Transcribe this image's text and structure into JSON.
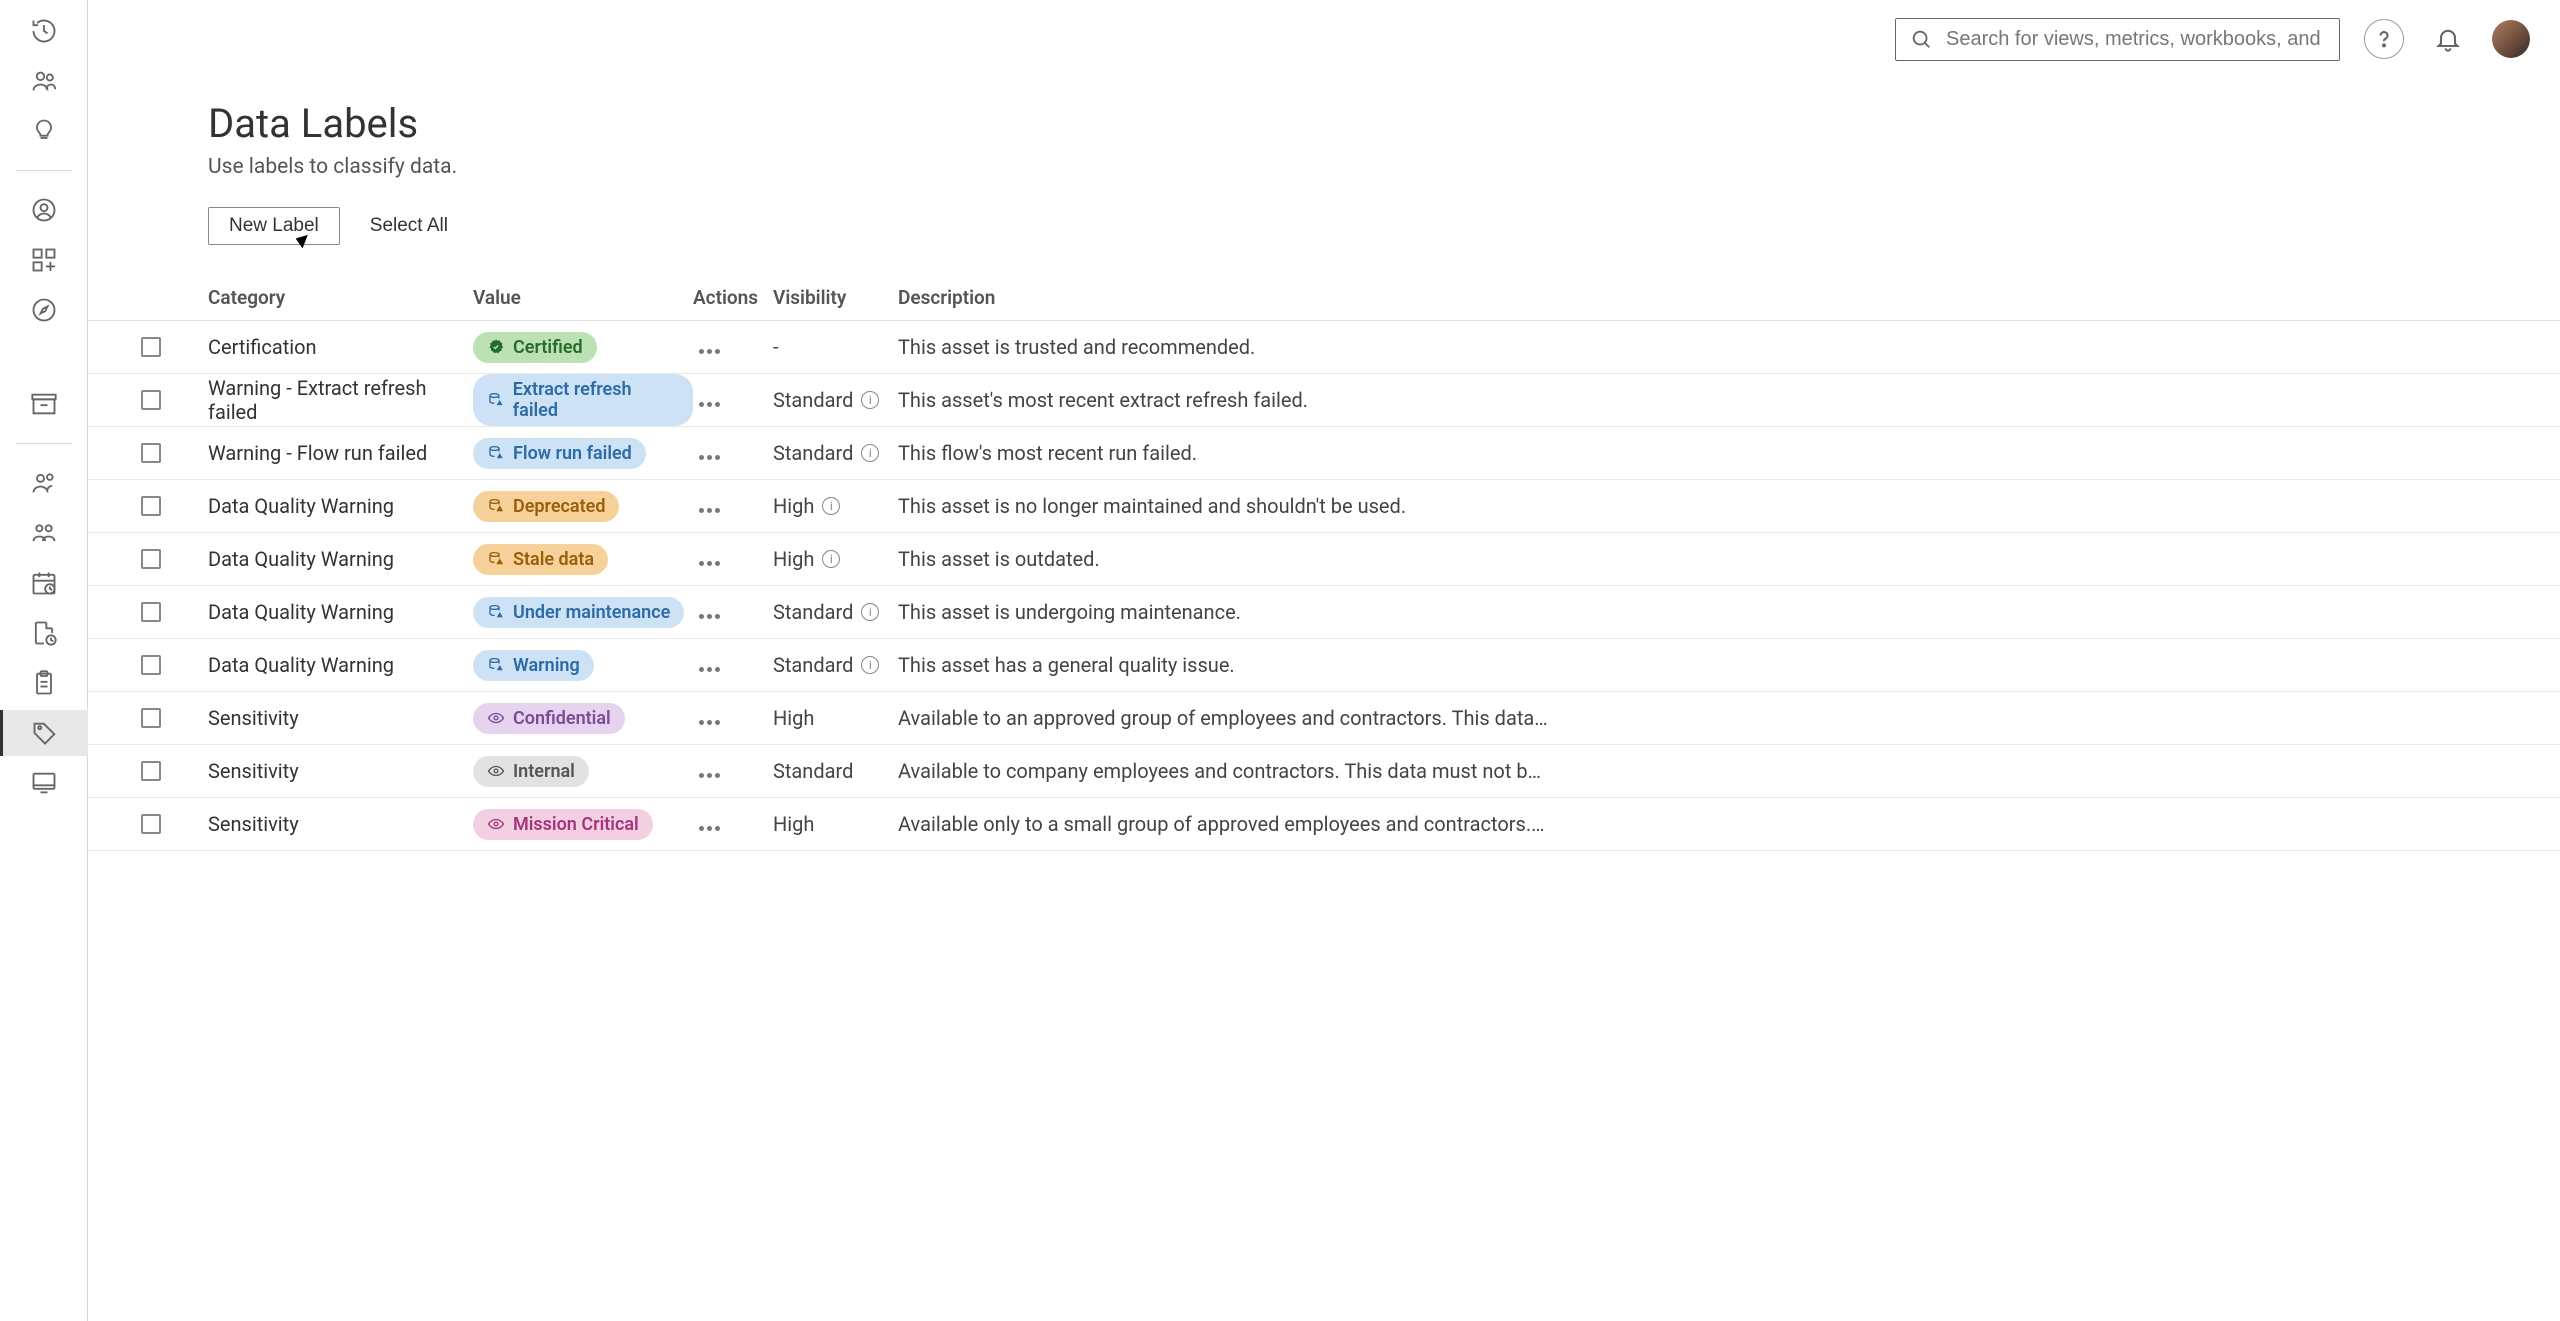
{
  "topbar": {
    "search_placeholder": "Search for views, metrics, workbooks, and more"
  },
  "page": {
    "title": "Data Labels",
    "subtitle": "Use labels to classify data.",
    "new_label_btn": "New Label",
    "select_all_btn": "Select All"
  },
  "columns": {
    "category": "Category",
    "value": "Value",
    "actions": "Actions",
    "visibility": "Visibility",
    "description": "Description"
  },
  "rows": [
    {
      "category": "Certification",
      "value_label": "Certified",
      "pill_class": "pill-green",
      "icon": "badge-check",
      "visibility": "-",
      "show_info": false,
      "description": "This asset is trusted and recommended."
    },
    {
      "category": "Warning - Extract refresh failed",
      "value_label": "Extract refresh failed",
      "pill_class": "pill-blue",
      "icon": "warn-db",
      "visibility": "Standard",
      "show_info": true,
      "description": "This asset's most recent extract refresh failed."
    },
    {
      "category": "Warning - Flow run failed",
      "value_label": "Flow run failed",
      "pill_class": "pill-blue",
      "icon": "warn-db",
      "visibility": "Standard",
      "show_info": true,
      "description": "This flow's most recent run failed."
    },
    {
      "category": "Data Quality Warning",
      "value_label": "Deprecated",
      "pill_class": "pill-orange",
      "icon": "warn-tri",
      "visibility": "High",
      "show_info": true,
      "description": "This asset is no longer maintained and shouldn't be used."
    },
    {
      "category": "Data Quality Warning",
      "value_label": "Stale data",
      "pill_class": "pill-orange",
      "icon": "warn-tri",
      "visibility": "High",
      "show_info": true,
      "description": "This asset is outdated."
    },
    {
      "category": "Data Quality Warning",
      "value_label": "Under maintenance",
      "pill_class": "pill-blue",
      "icon": "warn-db",
      "visibility": "Standard",
      "show_info": true,
      "description": "This asset is undergoing maintenance."
    },
    {
      "category": "Data Quality Warning",
      "value_label": "Warning",
      "pill_class": "pill-blue",
      "icon": "warn-db",
      "visibility": "Standard",
      "show_info": true,
      "description": "This asset has a general quality issue."
    },
    {
      "category": "Sensitivity",
      "value_label": "Confidential",
      "pill_class": "pill-purple",
      "icon": "eye",
      "visibility": "High",
      "show_info": false,
      "description": "Available to an approved group of employees and contractors. This data isn't restrict..."
    },
    {
      "category": "Sensitivity",
      "value_label": "Internal",
      "pill_class": "pill-gray",
      "icon": "eye",
      "visibility": "Standard",
      "show_info": false,
      "description": "Available to company employees and contractors. This data must not be shared pub..."
    },
    {
      "category": "Sensitivity",
      "value_label": "Mission Critical",
      "pill_class": "pill-pink",
      "icon": "eye",
      "visibility": "High",
      "show_info": false,
      "description": "Available only to a small group of approved employees and contractors. Third parties..."
    }
  ]
}
